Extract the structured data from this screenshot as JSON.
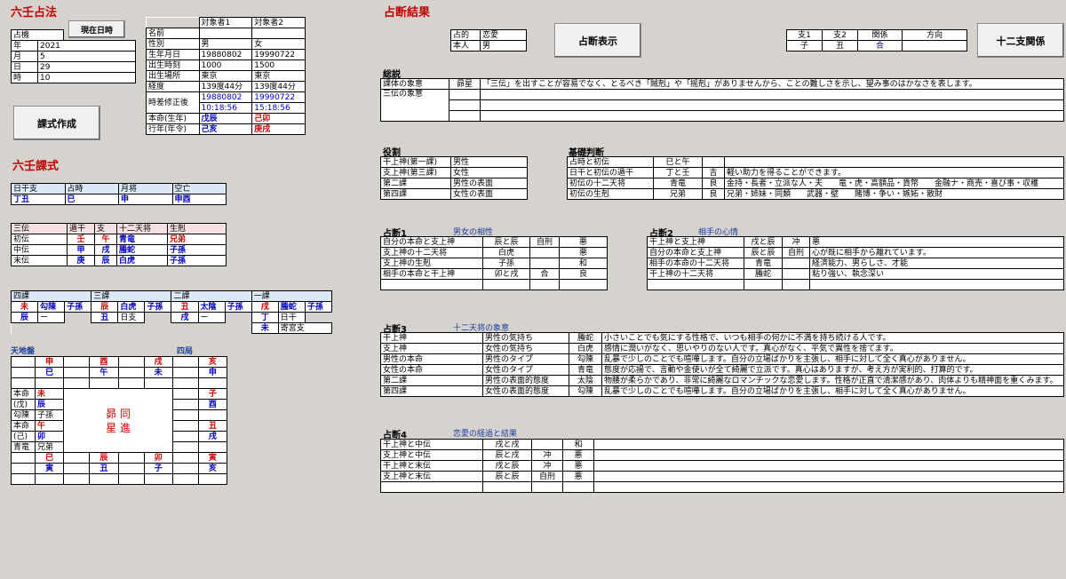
{
  "left_title": "六壬占法",
  "btn_now": "現在日時",
  "btn_create": "課式作成",
  "btn_show": "占断表示",
  "btn_zodiac": "十二支関係",
  "datetime": {
    "header": "占機",
    "rows": [
      [
        "年",
        "2021"
      ],
      [
        "月",
        "5"
      ],
      [
        "日",
        "29"
      ],
      [
        "時",
        "10"
      ]
    ]
  },
  "person": {
    "h1": "対象者1",
    "h2": "対象者2",
    "rows": [
      [
        "名前",
        "",
        ""
      ],
      [
        "性別",
        "男",
        "女"
      ],
      [
        "生年月日",
        "19880802",
        "19990722"
      ],
      [
        "出生時刻",
        "1000",
        "1500"
      ],
      [
        "出生場所",
        "東京",
        "東京"
      ],
      [
        "経度",
        "139度44分",
        "139度44分"
      ]
    ],
    "jisa_label": "時差修正後",
    "jisa1a": "19880802",
    "jisa2a": "19990722",
    "jisa1b": "10:18:56",
    "jisa2b": "15:18:56",
    "honmei_label": "本命(生年)",
    "honmei1": "戊辰",
    "honmei2": "己卯",
    "gyonen_label": "行年(年令)",
    "gyonen1": "己亥",
    "gyonen2": "庚戌"
  },
  "kashiki_title": "六壬課式",
  "k1": {
    "h": [
      "日干支",
      "占時",
      "月将",
      "空亡"
    ],
    "v": [
      "丁丑",
      "巳",
      "申",
      "申酉"
    ]
  },
  "sanden": {
    "h": [
      "三伝",
      "遁干",
      "支",
      "十二天将",
      "生剋"
    ],
    "rows": [
      [
        "初伝",
        "壬",
        "午",
        "青竜",
        "兄弟"
      ],
      [
        "中伝",
        "甲",
        "戌",
        "螣蛇",
        "子孫"
      ],
      [
        "末伝",
        "庚",
        "辰",
        "白虎",
        "子孫"
      ]
    ]
  },
  "shika": {
    "h": [
      "四課",
      "三課",
      "二課",
      "一課"
    ],
    "r1": [
      "未",
      "勾陳",
      "子孫",
      "辰",
      "白虎",
      "子孫",
      "丑",
      "太陰",
      "子孫",
      "戌",
      "螣蛇",
      "子孫"
    ],
    "r2": [
      "辰",
      "ー",
      "",
      "丑",
      "日支",
      "",
      "戌",
      "ー",
      "",
      "丁",
      "日干",
      ""
    ],
    "r3": "寄宮支",
    "r3a": "未"
  },
  "tenchi": {
    "title": "天地盤",
    "kyoku": "四局",
    "top_red": [
      "申",
      "酉",
      "戌",
      "亥"
    ],
    "top_blu": [
      "巳",
      "午",
      "未",
      "申"
    ],
    "left": [
      [
        "本命",
        "未"
      ],
      [
        "(戊)",
        "辰"
      ],
      [
        "勾陳",
        "子孫"
      ],
      [
        "本命",
        "午"
      ],
      [
        "(己)",
        "卯"
      ],
      [
        "青竜",
        "兄弟"
      ]
    ],
    "right_red": [
      "子",
      "丑"
    ],
    "right_blu": [
      "酉",
      "戌"
    ],
    "bot_red": [
      "巳",
      "辰",
      "卯",
      "寅"
    ],
    "bot_blu": [
      "寅",
      "丑",
      "子",
      "亥"
    ],
    "center": "昴 同\n星 進"
  },
  "result_title": "占断結果",
  "mokuteki": {
    "l1": "占的",
    "v1": "恋愛",
    "l2": "本人",
    "v2": "男"
  },
  "shi": {
    "h": [
      "支1",
      "支2",
      "関係",
      "方向"
    ],
    "v": [
      "子",
      "丑",
      "合",
      ""
    ]
  },
  "sosetsu": {
    "title": "総説",
    "rows": [
      [
        "課体の象意",
        "昴星",
        "「三伝」を出すことが容易でなく、とるべき「賊剋」や「摇剋」がありませんから、ことの難しさを示し、望み事のはかなさを表します。"
      ],
      [
        "三伝の象意",
        "",
        ""
      ]
    ]
  },
  "yakuwari": {
    "title": "役割",
    "rows": [
      [
        "干上神(第一課)",
        "男性"
      ],
      [
        "支上神(第三課)",
        "女性"
      ],
      [
        "第二課",
        "男性の表面"
      ],
      [
        "第四課",
        "女性の表面"
      ]
    ]
  },
  "kiso": {
    "title": "基礎判断",
    "rows": [
      [
        "占時と初伝",
        "巳と午",
        "",
        ""
      ],
      [
        "日干と初伝の遁干",
        "丁と壬",
        "吉",
        "軽い助力を得ることができます。"
      ],
      [
        "初伝の十二天将",
        "青竜",
        "良",
        "金持・長者・立派な人・夫　　竜・虎・高額品・貨幣　　金融ナ・商売・喜び事・収穫"
      ],
      [
        "初伝の生剋",
        "兄弟",
        "良",
        "兄弟・姉妹・同類　　武器・壁　　賭博・争い・嫉妬・散財"
      ]
    ]
  },
  "sen1": {
    "title": "占断1",
    "sub": "男女の相性",
    "rows": [
      [
        "自分の本命と支上神",
        "辰と辰",
        "自刑",
        "悪"
      ],
      [
        "支上神の十二天将",
        "白虎",
        "",
        "悪"
      ],
      [
        "支上神の生剋",
        "子孫",
        "",
        "和"
      ],
      [
        "相手の本命と干上神",
        "卯と戌",
        "合",
        "良"
      ]
    ]
  },
  "sen2": {
    "title": "占断2",
    "sub": "相手の心情",
    "rows": [
      [
        "干上神と支上神",
        "戌と辰",
        "冲",
        "悪"
      ],
      [
        "自分の本命と支上神",
        "辰と辰",
        "自刑",
        "心が既に相手から離れています。"
      ],
      [
        "相手の本命の十二天将",
        "青竜",
        "",
        "経済能力、男らしさ、才能"
      ],
      [
        "干上神の十二天将",
        "螣蛇",
        "",
        "粘り強い、執念深い"
      ]
    ]
  },
  "sen3": {
    "title": "占断3",
    "sub": "十二天将の象意",
    "rows": [
      [
        "干上神",
        "男性の気持ち",
        "螣蛇",
        "小さいことでも気にする性格で、いつも相手の何かに不満を持ち続ける人です。"
      ],
      [
        "支上神",
        "女性の気持ち",
        "白虎",
        "感情に潤いがなく、思いやりのない人です。真心がなく、平気で異性を捨てます。"
      ],
      [
        "男性の本命",
        "男性のタイプ",
        "勾陳",
        "乱暴で少しのことでも喧嘩します。自分の立場ばかりを主張し、相手に対して全く真心がありません。"
      ],
      [
        "女性の本命",
        "女性のタイプ",
        "青竜",
        "態度が応揚で、言動や金使いが全て綺麗で立派です。真心はありますが、考え方が実利的、打算的です。"
      ],
      [
        "第二課",
        "男性の表面的態度",
        "太陰",
        "物腰が柔らかであり、非常に綺麗なロマンチックな恋愛します。性格が正直で清潔感があり、肉体よりも精神面を重くみます。"
      ],
      [
        "第四課",
        "女性の表面的態度",
        "勾陳",
        "乱暴で少しのことでも喧嘩します。自分の立場ばかりを主張し、相手に対して全く真心がありません。"
      ]
    ]
  },
  "sen4": {
    "title": "占断4",
    "sub": "恋愛の経過と結果",
    "rows": [
      [
        "干上神と中伝",
        "戌と戌",
        "",
        "和"
      ],
      [
        "支上神と中伝",
        "辰と戌",
        "冲",
        "悪"
      ],
      [
        "干上神と末伝",
        "戌と辰",
        "冲",
        "悪"
      ],
      [
        "支上神と末伝",
        "辰と辰",
        "自刑",
        "悪"
      ]
    ]
  },
  "colors": {
    "bg": "#d6d3ce",
    "red": "#d00000",
    "blue": "#0000c0",
    "header": "#c00000"
  }
}
